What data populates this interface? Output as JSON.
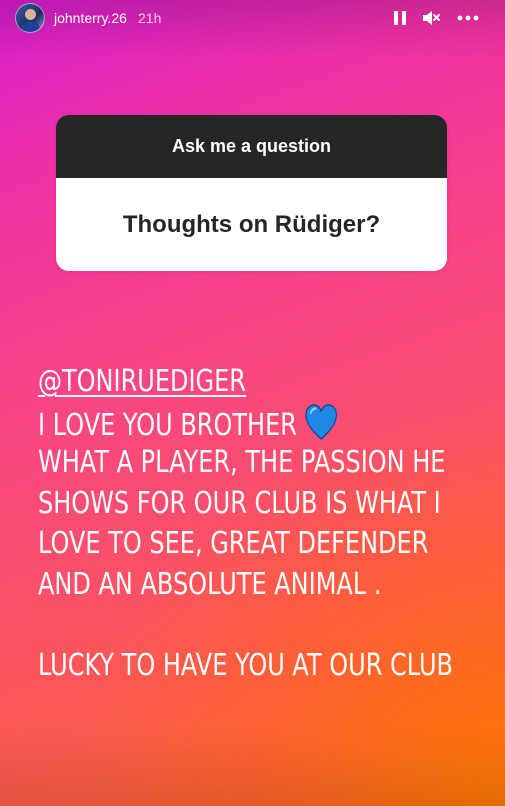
{
  "header": {
    "username": "johnterry.26",
    "time": "21h",
    "pause_icon": "pause-icon",
    "mute_icon": "speaker-muted-icon",
    "more_icon": "more-horizontal-icon"
  },
  "question_sticker": {
    "prompt": "Ask me a question",
    "question": "Thoughts on Rüdiger?"
  },
  "story_text": {
    "mention": "@TONIRUEDIGER",
    "line2": "I LOVE YOU BROTHER",
    "line2_emoji": "blue-heart-icon",
    "line3": "WHAT A PLAYER, THE PASSION HE",
    "line4": "SHOWS FOR OUR CLUB IS WHAT I",
    "line5": "LOVE TO SEE, GREAT DEFENDER",
    "line6": "AND AN ABSOLUTE ANIMAL .",
    "line7": "LUCKY TO HAVE YOU AT OUR CLUB"
  },
  "colors": {
    "gradient_top_left": "#d81ed0",
    "gradient_mid": "#f7428a",
    "gradient_bottom_right": "#fc7a1e",
    "sticker_header": "#262626",
    "sticker_body": "#ffffff",
    "heart": "#1e88e5"
  }
}
